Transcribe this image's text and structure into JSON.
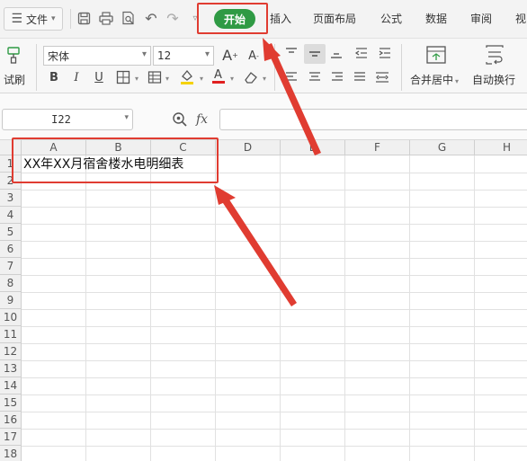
{
  "menubar": {
    "file_label": "文件",
    "tabs": {
      "start": "开始",
      "insert": "插入",
      "page_layout": "页面布局",
      "formula": "公式",
      "data": "数据",
      "review": "审阅",
      "view": "视"
    }
  },
  "ribbon": {
    "format_painter_label": "试刷",
    "font_name": "宋体",
    "font_size": "12",
    "merge_center_label": "合并居中",
    "wrap_text_label": "自动换行",
    "font_color": "#e02020",
    "fill_color": "#f5d200"
  },
  "formula_bar": {
    "name_box": "I22",
    "fx_label": "fx",
    "formula_value": ""
  },
  "sheet": {
    "columns": [
      "A",
      "B",
      "C",
      "D",
      "E",
      "F",
      "G",
      "H"
    ],
    "rows": [
      "1",
      "2",
      "3",
      "4",
      "5",
      "6",
      "7",
      "8",
      "9",
      "10",
      "11",
      "12",
      "13",
      "14",
      "15",
      "16",
      "17",
      "18"
    ],
    "cell_a1": "XX年XX月宿舍楼水电明细表"
  },
  "annotation": {
    "color": "#e03c31"
  }
}
